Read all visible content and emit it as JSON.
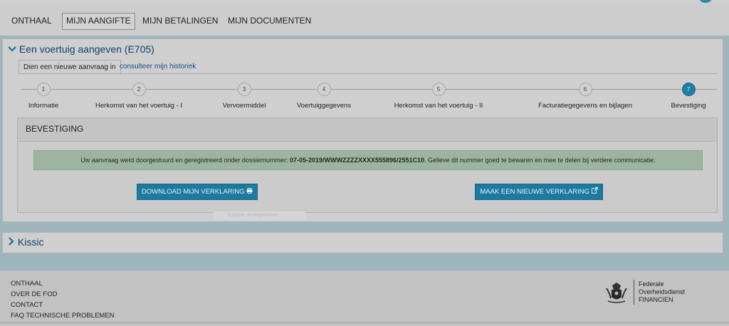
{
  "nav": {
    "items": [
      {
        "label": "ONTHAAL"
      },
      {
        "label": "MIJN AANGIFTE"
      },
      {
        "label": "MIJN BETALINGEN"
      },
      {
        "label": "MIJN DOCUMENTEN"
      }
    ]
  },
  "main_panel": {
    "title": "Een voertuig aangeven (E705)",
    "tabs": [
      {
        "label": "Dien een nieuwe aanvraag in"
      },
      {
        "label": "consulteer mijn historiek"
      }
    ],
    "steps": [
      {
        "number": "1",
        "label": "Informatie"
      },
      {
        "number": "2",
        "label": "Herkomst van het voertuig - I"
      },
      {
        "number": "3",
        "label": "Vervoermiddel"
      },
      {
        "number": "4",
        "label": "Voertuiggegevens"
      },
      {
        "number": "5",
        "label": "Herkomst van het voertuig - II"
      },
      {
        "number": "6",
        "label": "Facturatiegegevens en bijlagen"
      },
      {
        "number": "7",
        "label": "Bevestiging"
      }
    ],
    "current_step": 7,
    "confirmation": {
      "title": "BEVESTIGING",
      "message_prefix": "Uw aanvraag werd doorgestuurd en geregistreerd onder dossiernummer: ",
      "dossier_number": "07-05-2019/WWWZZZZXXXX555896/2551C10",
      "message_suffix": ". Gelieve dit nummer goed te bewaren en mee te delen bij verdere communicatie.",
      "download_button": "DOWNLOAD MIJN VERKLARING",
      "new_button": "MAAK EEN NIEUWE VERKLARING",
      "faint_text": "Explore rechtsgebiden"
    }
  },
  "collapsed_panel": {
    "title": "Kissic"
  },
  "footer": {
    "links": [
      {
        "label": "ONTHAAL"
      },
      {
        "label": "OVER DE FOD"
      },
      {
        "label": "CONTACT"
      },
      {
        "label": "FAQ TECHNISCHE PROBLEMEN"
      }
    ],
    "brand_lines": [
      "Federale",
      "Overheidsdienst",
      "FINANCIEN"
    ]
  },
  "icons": {
    "chevron": "chevron-icon",
    "printer": "printer-icon",
    "external": "external-link-icon",
    "logo": "belgian-coat-of-arms-icon"
  },
  "colors": {
    "accent": "#1c7aa0",
    "step_active": "#1e7fa6",
    "success_bg": "#9db5a0",
    "title": "#123f73"
  }
}
